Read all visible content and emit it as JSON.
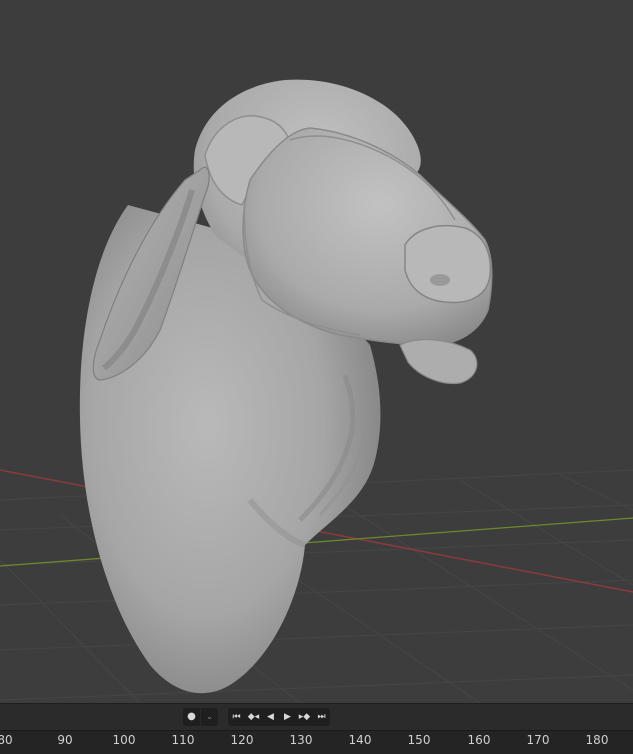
{
  "timeline": {
    "controls": [
      {
        "name": "record-keyframe-button",
        "icon": "record-icon",
        "glyph": "●"
      },
      {
        "name": "keying-dropdown-button",
        "icon": "chevron-down-icon",
        "glyph": "⌄"
      }
    ],
    "playback": [
      {
        "name": "jump-to-start-button",
        "icon": "jump-start-icon",
        "glyph": "⏮"
      },
      {
        "name": "prev-keyframe-button",
        "icon": "prev-keyframe-icon",
        "glyph": "◆◂"
      },
      {
        "name": "play-reverse-button",
        "icon": "play-reverse-icon",
        "glyph": "◀"
      },
      {
        "name": "play-button",
        "icon": "play-icon",
        "glyph": "▶"
      },
      {
        "name": "next-keyframe-button",
        "icon": "next-keyframe-icon",
        "glyph": "▸◆"
      },
      {
        "name": "jump-to-end-button",
        "icon": "jump-end-icon",
        "glyph": "⏭"
      }
    ],
    "ruler_labels": [
      "80",
      "90",
      "100",
      "110",
      "120",
      "130",
      "140",
      "150",
      "160",
      "170",
      "180"
    ]
  },
  "viewport": {
    "object": "sculpted-cow-head",
    "axis_colors": {
      "x_axis": "#8a3a3e",
      "y_axis": "#6b8a2e"
    },
    "background": "#3d3d3d"
  }
}
